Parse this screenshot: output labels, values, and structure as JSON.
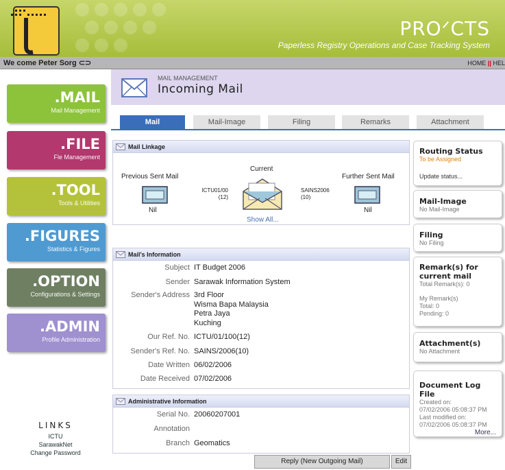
{
  "header": {
    "brand": "PROᐟCTS",
    "tagline": "Paperless Registry Operations and Case Tracking System"
  },
  "welcome": {
    "text": "We come Peter Sorg ⊂⊃",
    "home": "HOME",
    "help": "HEL"
  },
  "modules": [
    {
      "big": ".MAIL",
      "small": "Mail Management",
      "color": "#8dc33b"
    },
    {
      "big": ".FILE",
      "small": "Fle Management",
      "color": "#b2386d"
    },
    {
      "big": ".TOOL",
      "small": "Tools & Utilities",
      "color": "#b4c23b"
    },
    {
      "big": ".FIGURES",
      "small": "Statistics & Figures",
      "color": "#4f9ad1"
    },
    {
      "big": ".OPTION",
      "small": "Configurations & Settings",
      "color": "#6f8062"
    },
    {
      "big": ".ADMIN",
      "small": "Profile Administration",
      "color": "#9f90d0"
    }
  ],
  "links": {
    "title": "LINKS",
    "items": [
      "ICTU",
      "SarawakNet",
      "Change Password"
    ]
  },
  "page": {
    "crumb": "MAIL MANAGEMENT",
    "title": "Incoming Mail"
  },
  "tabs": [
    "Mail",
    "Mail-Image",
    "Filing",
    "Remarks",
    "Attachment"
  ],
  "linkage": {
    "heading": "Mail Linkage",
    "prev_label": "Previous Sent Mail",
    "prev_value": "Nil",
    "current_label": "Current",
    "ref_left": "ICTU01/00\n(12)",
    "ref_right": "SAINS2006\n(10)",
    "show_all": "Show All...",
    "next_label": "Further Sent Mail",
    "next_value": "Nil"
  },
  "info": {
    "heading": "Mail's Information",
    "rows": [
      {
        "label": "Subject",
        "value": "IT Budget 2006"
      },
      {
        "label": "Sender",
        "value": "Sarawak Information System"
      },
      {
        "label": "Sender's Address",
        "value": "3rd Floor\nWisma Bapa Malaysia\nPetra Jaya\nKuching"
      },
      {
        "label": "Our Ref. No.",
        "value": "ICTU/01/100(12)"
      },
      {
        "label": "Sender's Ref. No.",
        "value": "SAINS/2006(10)"
      },
      {
        "label": "Date Written",
        "value": "06/02/2006"
      },
      {
        "label": "Date Received",
        "value": "07/02/2006"
      }
    ]
  },
  "admin": {
    "heading": "Administrative Information",
    "rows": [
      {
        "label": "Serial No.",
        "value": "20060207001"
      },
      {
        "label": "Annotation",
        "value": ""
      },
      {
        "label": "Branch",
        "value": "Geomatics"
      }
    ]
  },
  "right": {
    "routing_title": "Routing Status",
    "routing_status": "To be Assigned",
    "routing_link": "Update status...",
    "image_title": "Mail-Image",
    "image_sub": "No Mail-Image",
    "filing_title": "Filing",
    "filing_sub": "No Filing",
    "remarks_title": "Remark(s) for current mail",
    "remarks_total": "Total Remark(s): 0",
    "my_remarks": "My Remark(s)",
    "my_total": "Total: 0",
    "my_pending": "Pending: 0",
    "attach_title": "Attachment(s)",
    "attach_sub": "No Attachment",
    "log_title": "Document Log File",
    "log_created_label": "Created on:",
    "log_created": "07/02/2006 05:08:37 PM",
    "log_modified_label": "Last modified on:",
    "log_modified": "07/02/2006 05:08:37 PM",
    "log_more": "More..."
  },
  "buttons": {
    "reply": "Reply (New Outgoing Mail)",
    "edit": "Edit"
  }
}
